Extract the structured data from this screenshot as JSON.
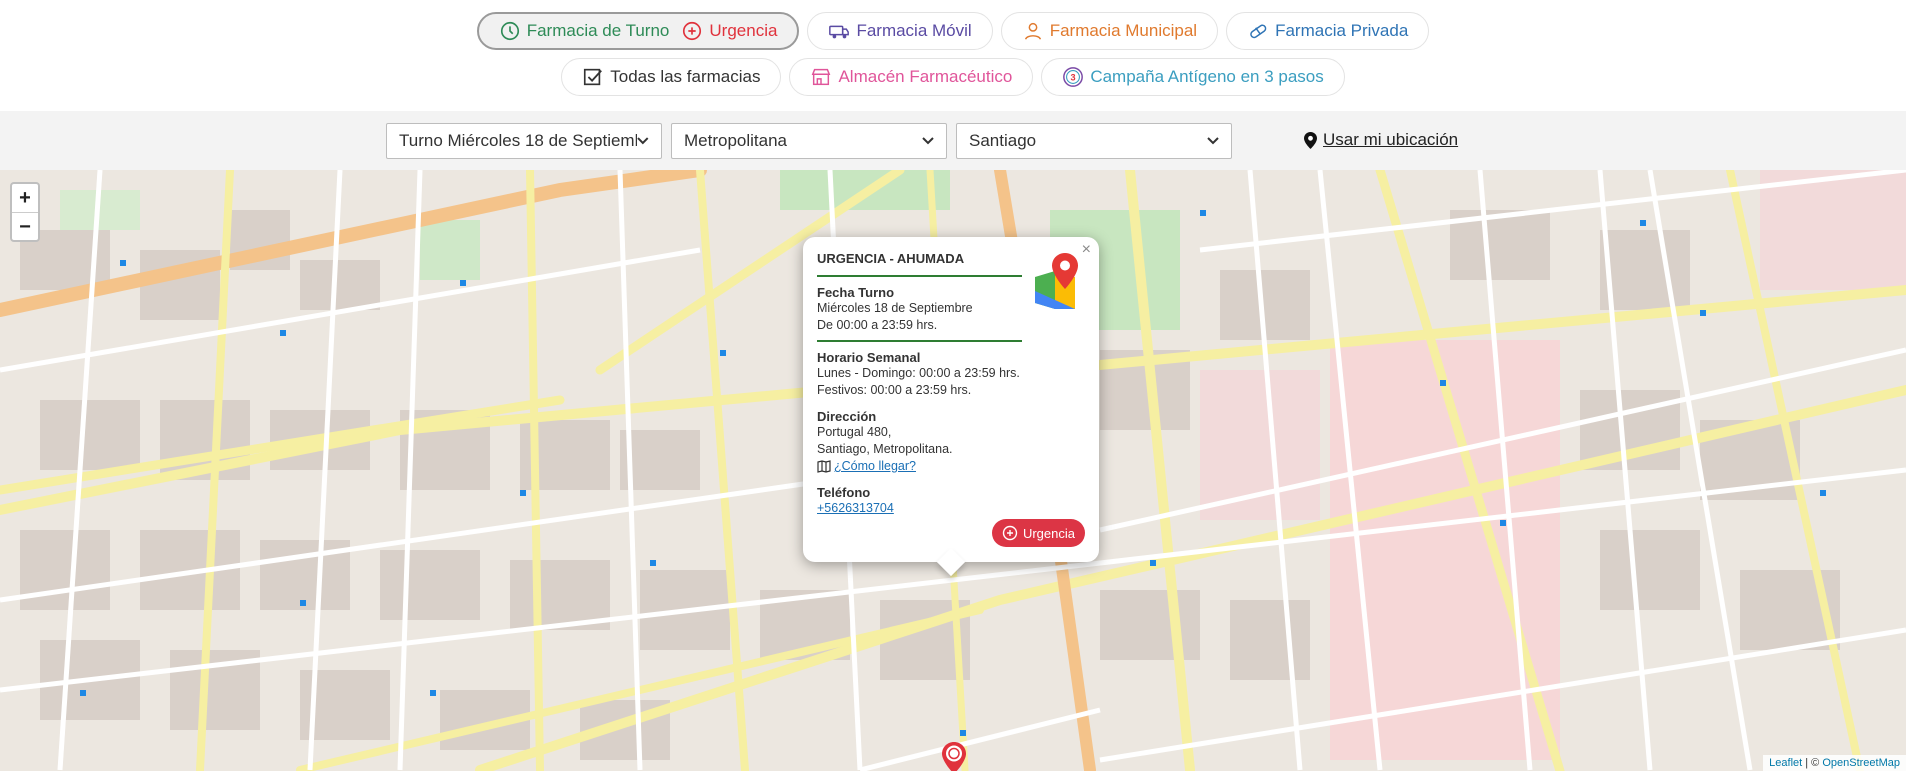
{
  "nav": {
    "row1": [
      {
        "label": "Farmacia de Turno",
        "icon": "clock-icon",
        "color": "#2e8b57"
      },
      {
        "label": "Urgencia",
        "icon": "urgency-icon",
        "color": "#e0323c"
      },
      {
        "label": "Farmacia Móvil",
        "icon": "van-icon",
        "color": "#5a4ba3"
      },
      {
        "label": "Farmacia Municipal",
        "icon": "person-icon",
        "color": "#e07a2e"
      },
      {
        "label": "Farmacia Privada",
        "icon": "pill-icon",
        "color": "#2f74b5"
      }
    ],
    "row2": [
      {
        "label": "Todas las farmacias",
        "icon": "checkbox-icon",
        "color": "#333333"
      },
      {
        "label": "Almacén Farmacéutico",
        "icon": "store-icon",
        "color": "#e0559a"
      },
      {
        "label": "Campaña Antígeno en 3 pasos",
        "icon": "number-3-icon",
        "color": "#3b9ec0"
      }
    ]
  },
  "filters": {
    "turno": "Turno Miércoles 18 de Septiemb",
    "region": "Metropolitana",
    "comuna": "Santiago",
    "location_link": "Usar mi ubicación"
  },
  "map": {
    "zoom_in": "+",
    "zoom_out": "−",
    "attribution_leaflet": "Leaflet",
    "attribution_sep": " | © ",
    "attribution_osm": "OpenStreetMap"
  },
  "popup": {
    "title": "URGENCIA - AHUMADA",
    "fecha_label": "Fecha Turno",
    "fecha_day": "Miércoles 18 de Septiembre",
    "fecha_hours": "De 00:00 a 23:59 hrs.",
    "horario_label": "Horario Semanal",
    "horario_week": "Lunes - Domingo: 00:00 a 23:59 hrs.",
    "horario_holidays": "Festivos: 00:00 a 23:59 hrs.",
    "direccion_label": "Dirección",
    "direccion_street": "Portugal 480,",
    "direccion_city": "Santiago, Metropolitana.",
    "directions_link": "¿Cómo llegar?",
    "telefono_label": "Teléfono",
    "telefono": "+5626313704",
    "badge": "Urgencia",
    "close": "×"
  },
  "colors": {
    "accent_green": "#2e7d32",
    "urgency_red": "#dc3545",
    "link_blue": "#1a6fb5"
  }
}
